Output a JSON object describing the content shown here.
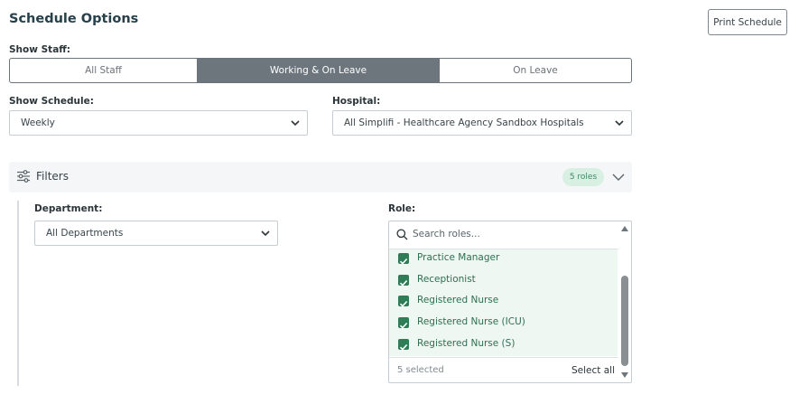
{
  "header": {
    "title": "Schedule Options",
    "print_label": "Print Schedule"
  },
  "show_staff": {
    "label": "Show Staff:",
    "options": [
      "All Staff",
      "Working & On Leave",
      "On Leave"
    ],
    "selected": "Working & On Leave"
  },
  "show_schedule": {
    "label": "Show Schedule:",
    "value": "Weekly"
  },
  "hospital": {
    "label": "Hospital:",
    "value": "All Simplifi - Healthcare Agency Sandbox Hospitals"
  },
  "filters": {
    "label": "Filters",
    "badge": "5 roles"
  },
  "department": {
    "label": "Department:",
    "value": "All Departments"
  },
  "role": {
    "label": "Role:",
    "placeholder": "Search roles...",
    "items": [
      {
        "label": "Practice Manager",
        "checked": true
      },
      {
        "label": "Receptionist",
        "checked": true
      },
      {
        "label": "Registered Nurse",
        "checked": true
      },
      {
        "label": "Registered Nurse (ICU)",
        "checked": true
      },
      {
        "label": "Registered Nurse (S)",
        "checked": true
      }
    ],
    "selected_count": "5 selected",
    "select_all_label": "Select all"
  },
  "colors": {
    "accent_green": "#2e7d57",
    "segment_active": "#6d767d",
    "badge_bg": "#d8efe3",
    "title": "#27404a"
  }
}
